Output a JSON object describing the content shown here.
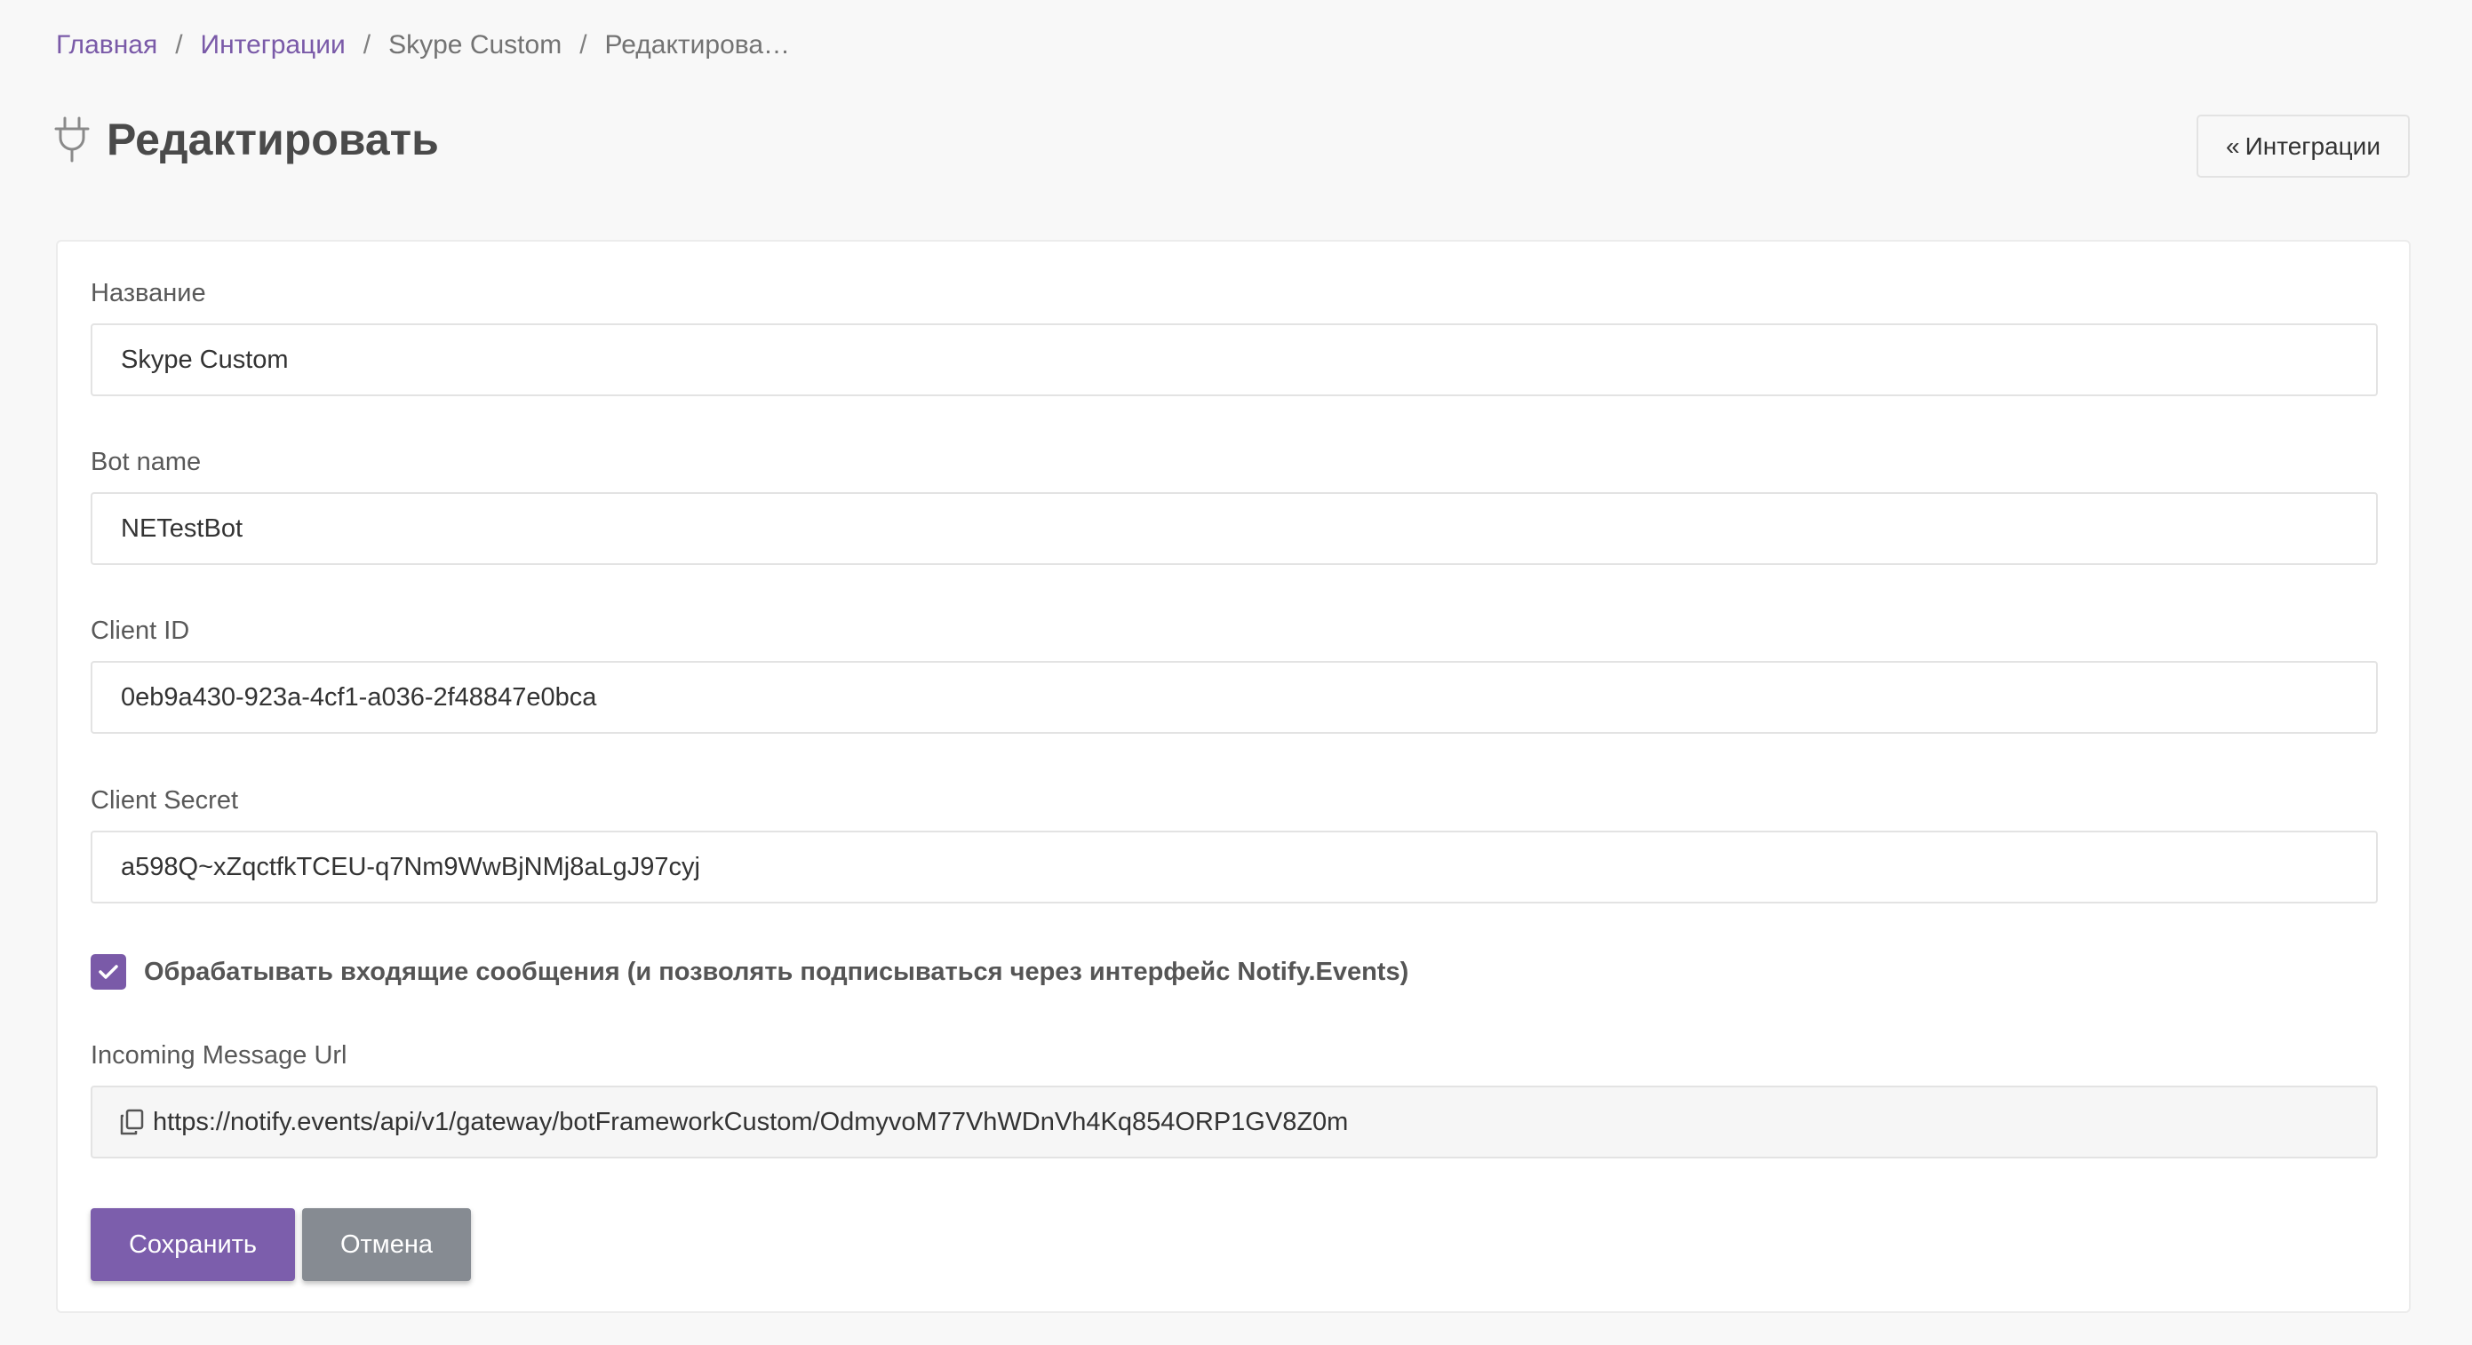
{
  "breadcrumb": {
    "items": [
      "Главная",
      "Интеграции",
      "Skype Custom",
      "Редактирова…"
    ],
    "separator": "/"
  },
  "header": {
    "icon": "plug-icon",
    "title": "Редактировать",
    "back_button_label": "Интеграции",
    "back_icon": "«"
  },
  "form": {
    "name": {
      "label": "Название",
      "value": "Skype Custom"
    },
    "bot_name": {
      "label": "Bot name",
      "value": "NETestBot"
    },
    "client_id": {
      "label": "Client ID",
      "value": "0eb9a430-923a-4cf1-a036-2f48847e0bca"
    },
    "client_secret": {
      "label": "Client Secret",
      "value": "a598Q~xZqctfkTCEU-q7Nm9WwBjNMj8aLgJ97cyj"
    },
    "process_incoming": {
      "label": "Обрабатывать входящие сообщения (и позволять подписываться через интерфейс Notify.Events)",
      "checked": true
    },
    "incoming_url": {
      "label": "Incoming Message Url",
      "value": "https://notify.events/api/v1/gateway/botFrameworkCustom/OdmyvoM77VhWDnVh4Kq854ORP1GV8Z0m"
    }
  },
  "actions": {
    "save_label": "Сохранить",
    "cancel_label": "Отмена"
  },
  "colors": {
    "accent": "#7c5eac",
    "link": "#7a5aa8",
    "cancel": "#868b92",
    "background": "#f8f8f8"
  }
}
